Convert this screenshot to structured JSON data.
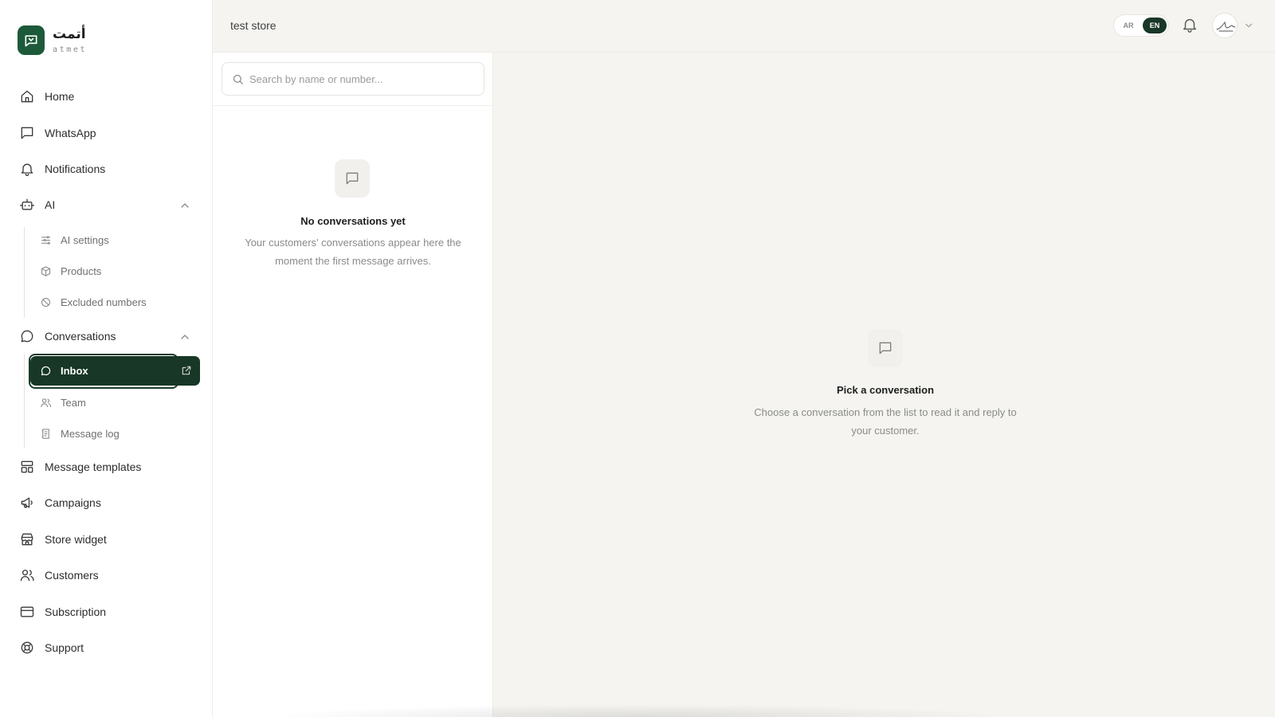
{
  "brand": {
    "name_ar": "أتمت",
    "name_en": "atmet"
  },
  "sidebar": {
    "items": [
      {
        "label": "Home"
      },
      {
        "label": "WhatsApp"
      },
      {
        "label": "Notifications"
      },
      {
        "label": "AI"
      },
      {
        "label": "Conversations"
      },
      {
        "label": "Message templates"
      },
      {
        "label": "Campaigns"
      },
      {
        "label": "Store widget"
      },
      {
        "label": "Customers"
      },
      {
        "label": "Subscription"
      },
      {
        "label": "Support"
      }
    ],
    "ai_sub": [
      {
        "label": "AI settings"
      },
      {
        "label": "Products"
      },
      {
        "label": "Excluded numbers"
      }
    ],
    "conversations_sub": [
      {
        "label": "Inbox",
        "active": true
      },
      {
        "label": "Team"
      },
      {
        "label": "Message log"
      }
    ]
  },
  "topbar": {
    "store_name": "test store",
    "lang": {
      "ar": "AR",
      "en": "EN",
      "selected": "EN"
    }
  },
  "conversation_list": {
    "search_placeholder": "Search by name or number...",
    "empty_title": "No conversations yet",
    "empty_desc_line1": "Your customers' conversations appear here the",
    "empty_desc_line2": "moment the first message arrives."
  },
  "detail": {
    "empty_title": "Pick a conversation",
    "empty_desc_line1": "Choose a conversation from the list to read it and reply to",
    "empty_desc_line2": "your customer."
  },
  "colors": {
    "brand_dark": "#183726",
    "logo_green": "#1d5a3a",
    "page_bg": "#f5f4f1"
  }
}
